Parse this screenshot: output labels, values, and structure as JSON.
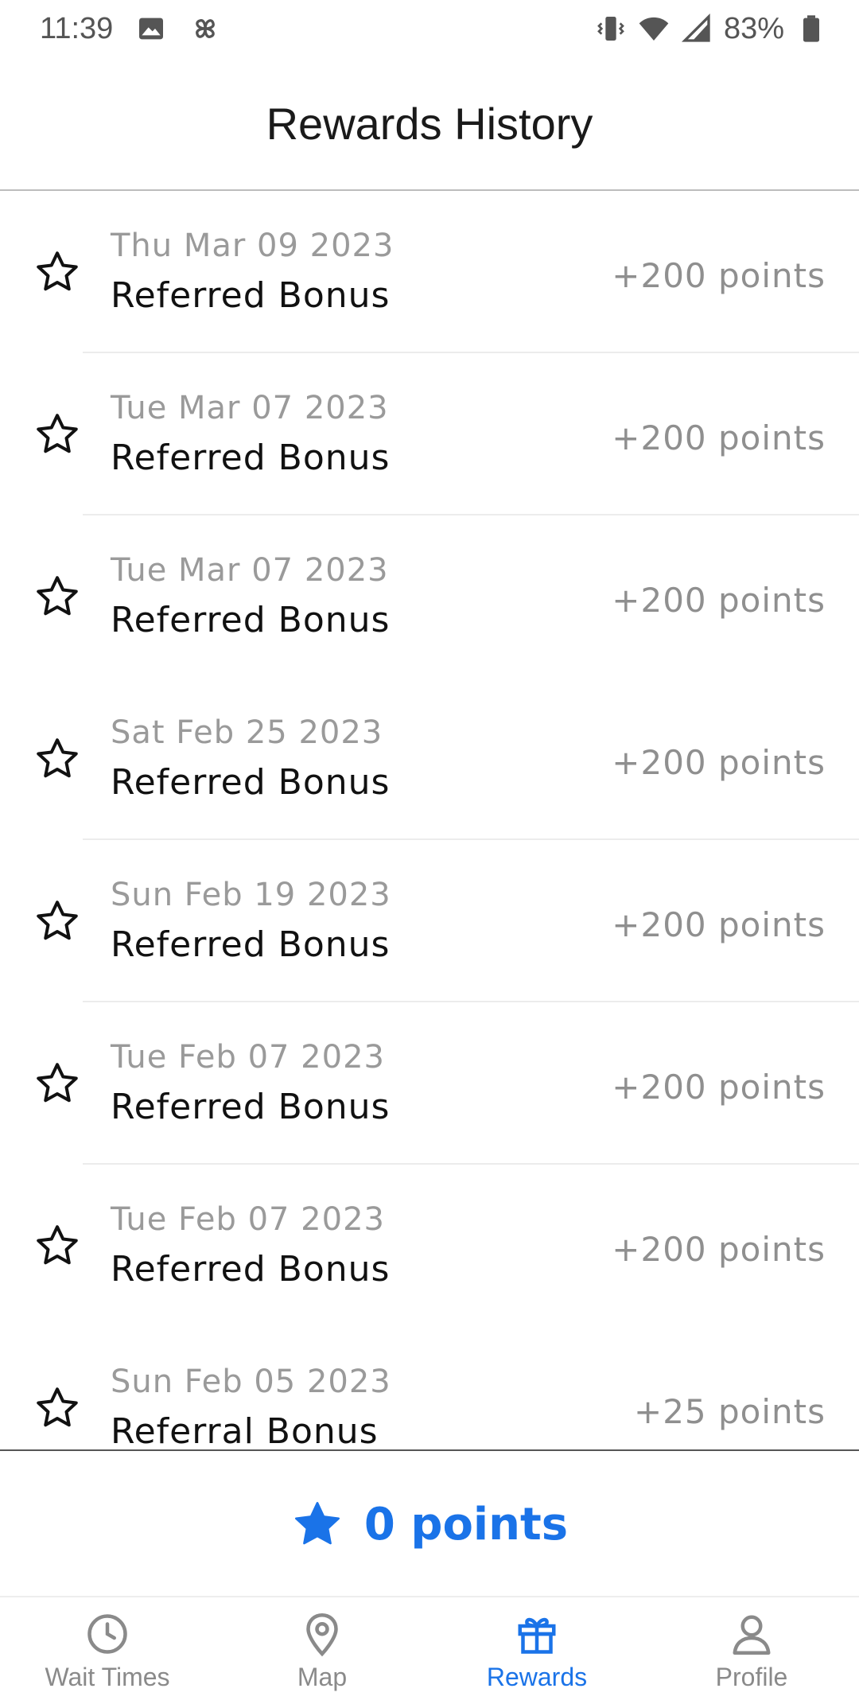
{
  "status_bar": {
    "time": "11:39",
    "battery": "83%",
    "icons_left": [
      "image-icon",
      "pinwheel-icon"
    ],
    "icons_right": [
      "vibrate-icon",
      "wifi-icon",
      "signal-icon",
      "battery-icon"
    ]
  },
  "header": {
    "title": "Rewards History"
  },
  "rewards": [
    {
      "date": "Thu Mar 09 2023",
      "title": "Referred Bonus",
      "points": "+200 points"
    },
    {
      "date": "Tue Mar 07 2023",
      "title": "Referred Bonus",
      "points": "+200 points"
    },
    {
      "date": "Tue Mar 07 2023",
      "title": "Referred Bonus",
      "points": "+200 points"
    },
    {
      "date": "Sat Feb 25 2023",
      "title": "Referred Bonus",
      "points": "+200 points"
    },
    {
      "date": "Sun Feb 19 2023",
      "title": "Referred Bonus",
      "points": "+200 points"
    },
    {
      "date": "Tue Feb 07 2023",
      "title": "Referred Bonus",
      "points": "+200 points"
    },
    {
      "date": "Tue Feb 07 2023",
      "title": "Referred Bonus",
      "points": "+200 points"
    },
    {
      "date": "Sun Feb 05 2023",
      "title": "Referral Bonus",
      "points": "+25 points"
    }
  ],
  "summary": {
    "points_label": "0 points",
    "icon": "star-filled-icon"
  },
  "bottom_nav": {
    "items": [
      {
        "label": "Wait Times",
        "icon": "clock-icon",
        "active": false
      },
      {
        "label": "Map",
        "icon": "map-pin-icon",
        "active": false
      },
      {
        "label": "Rewards",
        "icon": "gift-icon",
        "active": true
      },
      {
        "label": "Profile",
        "icon": "user-icon",
        "active": false
      }
    ]
  },
  "colors": {
    "accent": "#1a73e8",
    "muted_text": "#9a9a9a",
    "divider": "#ececec"
  }
}
